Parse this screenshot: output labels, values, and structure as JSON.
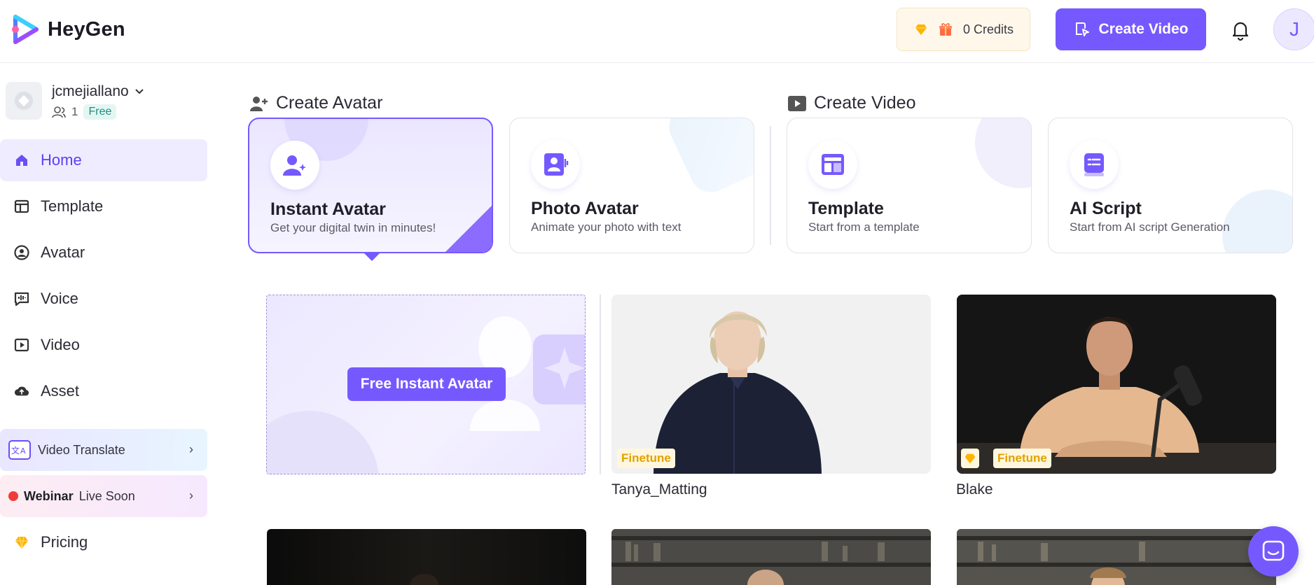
{
  "app": {
    "name": "HeyGen"
  },
  "topbar": {
    "credits_label": "0 Credits",
    "create_video_label": "Create Video",
    "user_initial": "J"
  },
  "sidebar": {
    "username": "jcmejiallano",
    "members_count": "1",
    "plan": "Free",
    "nav": [
      {
        "label": "Home",
        "icon": "home-icon",
        "active": true
      },
      {
        "label": "Template",
        "icon": "template-icon"
      },
      {
        "label": "Avatar",
        "icon": "avatar-icon"
      },
      {
        "label": "Voice",
        "icon": "voice-icon"
      },
      {
        "label": "Video",
        "icon": "video-icon"
      },
      {
        "label": "Asset",
        "icon": "upload-cloud-icon"
      }
    ],
    "video_translate_label": "Video Translate",
    "webinar_label": "Webinar",
    "webinar_status": "Live Soon",
    "pricing_label": "Pricing"
  },
  "create_avatar": {
    "title": "Create Avatar",
    "cards": [
      {
        "title": "Instant Avatar",
        "subtitle": "Get your digital twin in minutes!"
      },
      {
        "title": "Photo Avatar",
        "subtitle": "Animate your photo with text"
      }
    ]
  },
  "create_video": {
    "title": "Create Video",
    "cards": [
      {
        "title": "Template",
        "subtitle": "Start from a template"
      },
      {
        "title": "AI Script",
        "subtitle": "Start from AI script Generation"
      }
    ]
  },
  "avatars": {
    "free_instant_label": "Free Instant Avatar",
    "items": [
      {
        "name": "Tanya_Matting",
        "badge": "Finetune"
      },
      {
        "name": "Blake",
        "badge": "Finetune"
      }
    ]
  },
  "colors": {
    "accent": "#7559ff",
    "badge_text": "#e2a100"
  }
}
